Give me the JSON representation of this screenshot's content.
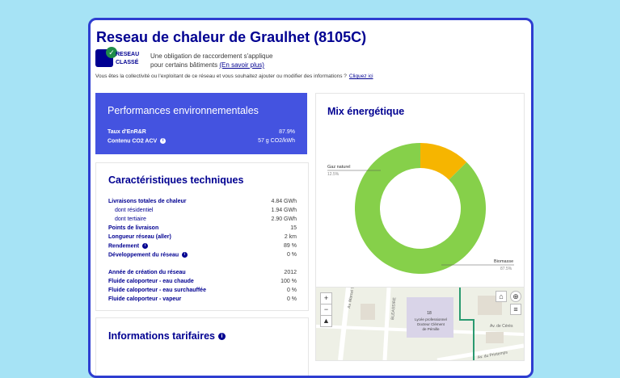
{
  "header": {
    "title": "Reseau de chaleur de Graulhet (8105C)",
    "badge_line1": "RESEAU",
    "badge_line2": "CLASSÉ",
    "obligation_line1": "Une obligation de raccordement s'applique",
    "obligation_line2": "pour certains bâtiments",
    "learn_more": "(En savoir plus)",
    "contrib_text": "Vous êtes la collectivité ou l'exploitant de ce réseau et vous souhaitez ajouter ou modifier des informations ?",
    "contrib_link": "Cliquez ici"
  },
  "performances": {
    "title": "Performances environnementales",
    "rows": [
      {
        "label": "Taux d'EnR&R",
        "value": "87.9%"
      },
      {
        "label": "Contenu CO2 ACV",
        "value": "57 g CO2/kWh"
      }
    ]
  },
  "technical": {
    "title": "Caractéristiques techniques",
    "rows": [
      {
        "label": "Livraisons totales de chaleur",
        "value": "4.84 GWh"
      },
      {
        "label": "dont résidentiel",
        "value": "1.94 GWh"
      },
      {
        "label": "dont tertiaire",
        "value": "2.90 GWh"
      },
      {
        "label": "Points de livraison",
        "value": "15"
      },
      {
        "label": "Longueur réseau (aller)",
        "value": "2 km"
      },
      {
        "label": "Rendement",
        "value": "89 %"
      },
      {
        "label": "Développement du réseau",
        "value": "0 %"
      },
      {
        "label": "Année de création du réseau",
        "value": "2012"
      },
      {
        "label": "Fluide caloporteur - eau chaude",
        "value": "100 %"
      },
      {
        "label": "Fluide caloporteur - eau surchauffée",
        "value": "0 %"
      },
      {
        "label": "Fluide caloporteur - vapeur",
        "value": "0 %"
      }
    ]
  },
  "tarifs": {
    "title": "Informations tarifaires"
  },
  "mix": {
    "title": "Mix énergétique",
    "label_gaz": "Gaz naturel",
    "label_gaz_pct": "12.5%",
    "label_bio": "Biomasse",
    "label_bio_pct": "87.5%",
    "color_gaz": "#f6b500",
    "color_bio": "#86d04a"
  },
  "chart_data": {
    "type": "pie",
    "categories": [
      "Gaz naturel",
      "Biomasse"
    ],
    "values": [
      12.5,
      87.5
    ],
    "title": "Mix énergétique"
  },
  "map": {
    "street1": "Av. Marcel Ta...",
    "street2": "BLEASSIRE",
    "building_num": "18",
    "school_line1": "Lycée professionnel",
    "school_line2": "Docteur Clément",
    "school_line3": "de Pémille",
    "street3": "Av. du Printemps",
    "street4": "Av. de Cérès"
  },
  "colors": {
    "brand": "#000091",
    "accent_panel": "#4453e0",
    "frame": "#2e3dd0",
    "background": "#a6e3f5"
  }
}
